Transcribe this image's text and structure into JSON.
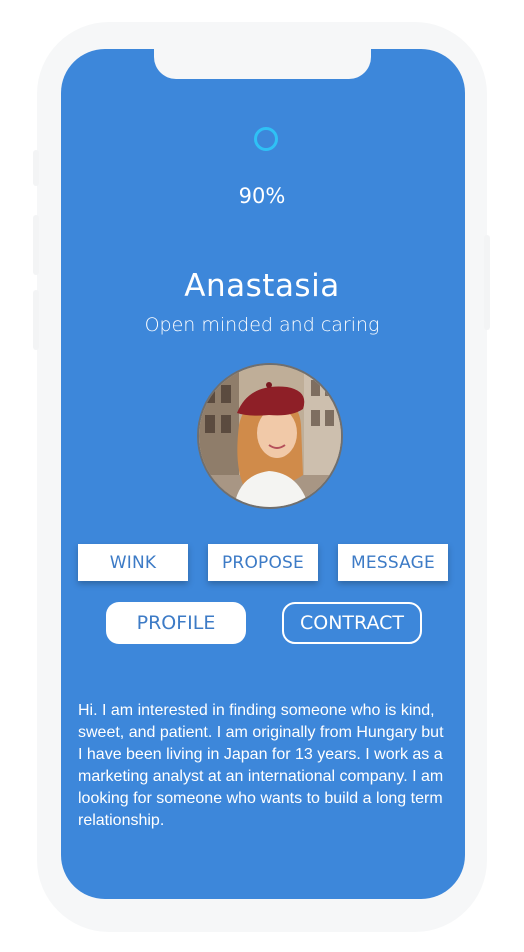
{
  "status": {
    "progress_percent": 90,
    "progress_label": "90%"
  },
  "profile": {
    "name": "Anastasia",
    "tagline": "Open minded and caring",
    "avatar_alt": "avatar"
  },
  "actions": [
    {
      "label": "WINK"
    },
    {
      "label": "PROPOSE"
    },
    {
      "label": "MESSAGE"
    }
  ],
  "tabs": {
    "profile_label": "PROFILE",
    "contract_label": "CONTRACT"
  },
  "bio": {
    "text": "Hi. I am interested in finding someone who is kind, sweet, and patient. I am originally from Hungary but I have been living in Japan for 13 years. I work as a marketing analyst at an international company. I am looking for someone who wants to build a long term relationship."
  },
  "colors": {
    "screen_bg": "#3d87da",
    "accent_ring": "#2fc1f5",
    "button_text": "#3d7bc6",
    "frame": "#f6f7f8"
  }
}
